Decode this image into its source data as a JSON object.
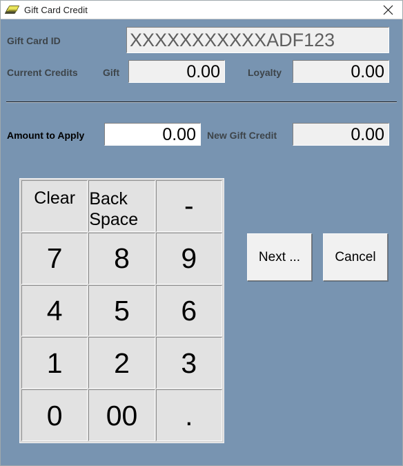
{
  "window": {
    "title": "Gift Card Credit",
    "icon": "gift-card-icon",
    "close_glyph": "×",
    "background_color": "#7894b1"
  },
  "form": {
    "gift_card_id": {
      "label": "Gift Card ID",
      "value": "XXXXXXXXXXXADF123",
      "readonly": true
    },
    "current_credits": {
      "label": "Current Credits",
      "gift": {
        "label": "Gift",
        "value": "0.00",
        "readonly": true
      },
      "loyalty": {
        "label": "Loyalty",
        "value": "0.00",
        "readonly": true
      }
    },
    "amount_to_apply": {
      "label": "Amount to Apply",
      "value": "0.00",
      "readonly": false
    },
    "new_gift_credit": {
      "label": "New Gift Credit",
      "value": "0.00",
      "readonly": true
    }
  },
  "keypad": {
    "keys": [
      {
        "label": "Clear",
        "name": "key-clear",
        "type": "word"
      },
      {
        "label": "Back\nSpace",
        "name": "key-backspace",
        "type": "word"
      },
      {
        "label": "-",
        "name": "key-minus",
        "type": "sym"
      },
      {
        "label": "7",
        "name": "key-7",
        "type": "digit"
      },
      {
        "label": "8",
        "name": "key-8",
        "type": "digit"
      },
      {
        "label": "9",
        "name": "key-9",
        "type": "digit"
      },
      {
        "label": "4",
        "name": "key-4",
        "type": "digit"
      },
      {
        "label": "5",
        "name": "key-5",
        "type": "digit"
      },
      {
        "label": "6",
        "name": "key-6",
        "type": "digit"
      },
      {
        "label": "1",
        "name": "key-1",
        "type": "digit"
      },
      {
        "label": "2",
        "name": "key-2",
        "type": "digit"
      },
      {
        "label": "3",
        "name": "key-3",
        "type": "digit"
      },
      {
        "label": "0",
        "name": "key-0",
        "type": "digit"
      },
      {
        "label": "00",
        "name": "key-double-zero",
        "type": "digit"
      },
      {
        "label": ".",
        "name": "key-decimal",
        "type": "sym"
      }
    ]
  },
  "actions": {
    "next_label": "Next ...",
    "cancel_label": "Cancel"
  }
}
